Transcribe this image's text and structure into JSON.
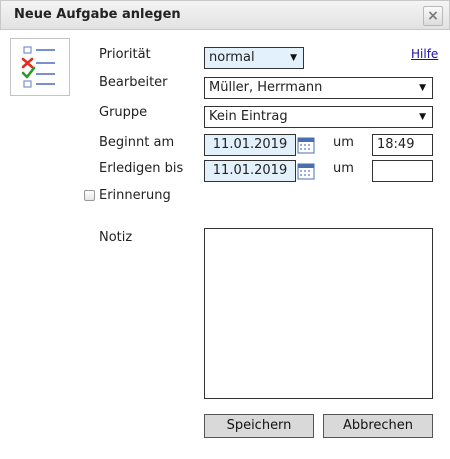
{
  "dialog": {
    "title": "Neue Aufgabe anlegen",
    "close_label": "×"
  },
  "form": {
    "prioritaet_label": "Priorität",
    "prioritaet_value": "normal",
    "bearbeiter_label": "Bearbeiter",
    "bearbeiter_value": "Müller, Herrmann",
    "gruppe_label": "Gruppe",
    "gruppe_value": "Kein Eintrag",
    "beginnt_label": "Beginnt am",
    "beginnt_date": "11.01.2019",
    "beginnt_um_label": "um",
    "beginnt_time": "18:49",
    "erledigen_label": "Erledigen bis",
    "erledigen_date": "11.01.2019",
    "erledigen_um_label": "um",
    "erledigen_time": "",
    "erinnerung_label": "Erinnerung",
    "notiz_label": "Notiz",
    "notiz_value": "",
    "hilfe_link": "Hilfe"
  },
  "buttons": {
    "save": "Speichern",
    "cancel": "Abbrechen"
  },
  "icons": {
    "app": "task-checklist-icon",
    "calendar": "calendar-icon",
    "dropdown": "chevron-down-icon",
    "close": "close-icon"
  }
}
